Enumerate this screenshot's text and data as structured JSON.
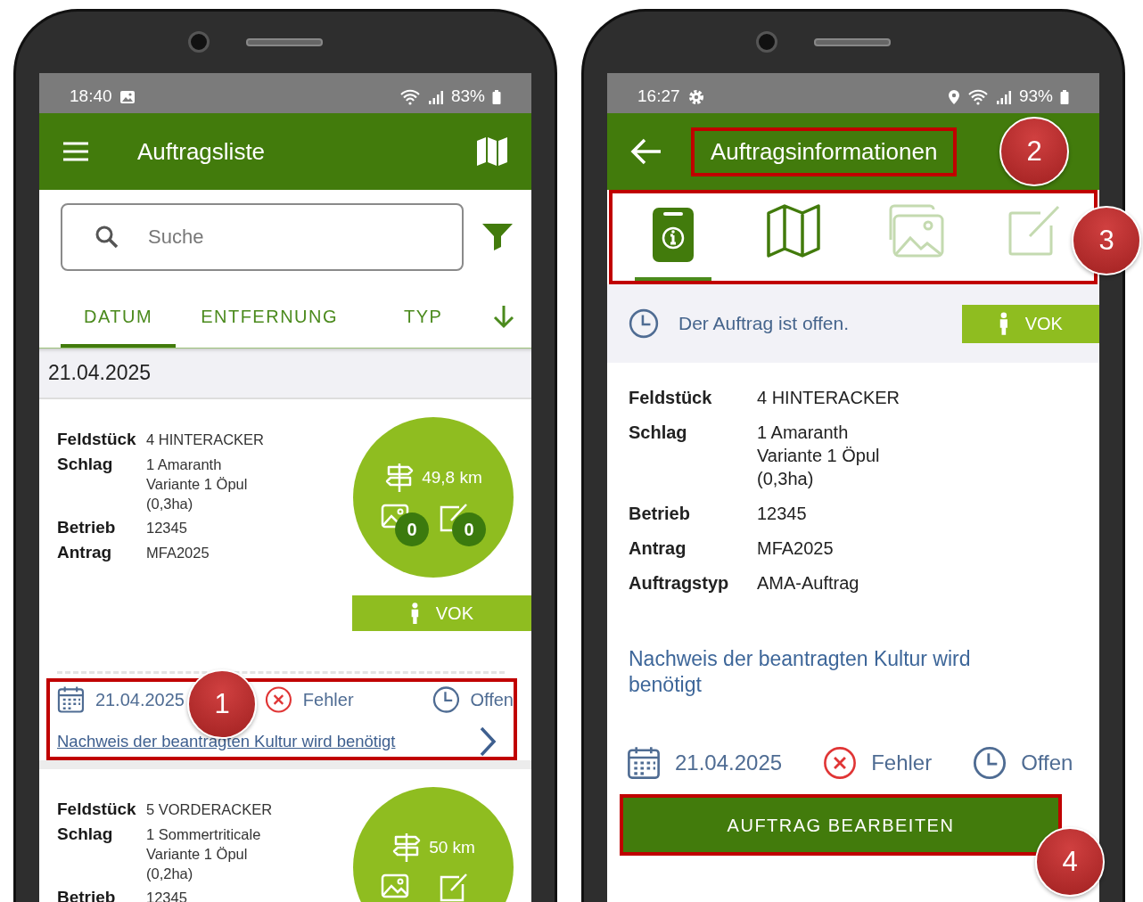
{
  "list_screen": {
    "status_bar": {
      "time": "18:40",
      "battery": "83%"
    },
    "app_bar": {
      "title": "Auftragsliste"
    },
    "search": {
      "placeholder": "Suche"
    },
    "sort_tabs": [
      {
        "label": "DATUM",
        "selected": true
      },
      {
        "label": "ENTFERNUNG",
        "selected": false
      },
      {
        "label": "TYP",
        "selected": false
      }
    ],
    "date_header": "21.04.2025",
    "orders": [
      {
        "fields": [
          {
            "label": "Feldstück",
            "lines": [
              "4 HINTERACKER"
            ]
          },
          {
            "label": "Schlag",
            "lines": [
              "1 Amaranth",
              "Variante 1 Öpul",
              "(0,3ha)"
            ]
          },
          {
            "label": "Betrieb",
            "lines": [
              "12345"
            ]
          },
          {
            "label": "Antrag",
            "lines": [
              "MFA2025"
            ]
          }
        ],
        "distance": "49,8 km",
        "photo_count": "0",
        "note_count": "0",
        "badge": "VOK",
        "footer": {
          "date": "21.04.2025",
          "error": "Fehler",
          "status": "Offen",
          "message": "Nachweis der beantragten Kultur wird benötigt",
          "highlighted": true
        }
      },
      {
        "fields": [
          {
            "label": "Feldstück",
            "lines": [
              "5 VORDERACKER"
            ]
          },
          {
            "label": "Schlag",
            "lines": [
              "1 Sommertriticale",
              "Variante 1 Öpul",
              "(0,2ha)"
            ]
          },
          {
            "label": "Betrieb",
            "lines": [
              "12345"
            ]
          }
        ],
        "distance": "50 km"
      }
    ]
  },
  "detail_screen": {
    "status_bar": {
      "time": "16:27",
      "battery": "93%"
    },
    "app_bar": {
      "title": "Auftragsinformationen",
      "highlighted": true
    },
    "tabs_highlighted": true,
    "tabs": [
      {
        "kind": "info",
        "selected": true,
        "disabled": false
      },
      {
        "kind": "map",
        "selected": false,
        "disabled": false
      },
      {
        "kind": "photos",
        "selected": false,
        "disabled": true
      },
      {
        "kind": "notes",
        "selected": false,
        "disabled": true
      }
    ],
    "status": {
      "text": "Der Auftrag ist offen.",
      "badge": "VOK"
    },
    "fields": [
      {
        "label": "Feldstück",
        "lines": [
          "4 HINTERACKER"
        ]
      },
      {
        "label": "Schlag",
        "lines": [
          "1 Amaranth",
          "Variante 1 Öpul",
          "(0,3ha)"
        ]
      },
      {
        "label": "Betrieb",
        "lines": [
          "12345"
        ]
      },
      {
        "label": "Antrag",
        "lines": [
          "MFA2025"
        ]
      },
      {
        "label": "Auftragstyp",
        "lines": [
          "AMA-Auftrag"
        ]
      }
    ],
    "message": "Nachweis der beantragten Kultur wird benötigt",
    "footer": {
      "date": "21.04.2025",
      "error": "Fehler",
      "status": "Offen"
    },
    "action_button": {
      "label": "AUFTRAG BEARBEITEN",
      "highlighted": true
    }
  },
  "callouts": [
    {
      "number": "1"
    },
    {
      "number": "2"
    },
    {
      "number": "3"
    },
    {
      "number": "4"
    }
  ]
}
